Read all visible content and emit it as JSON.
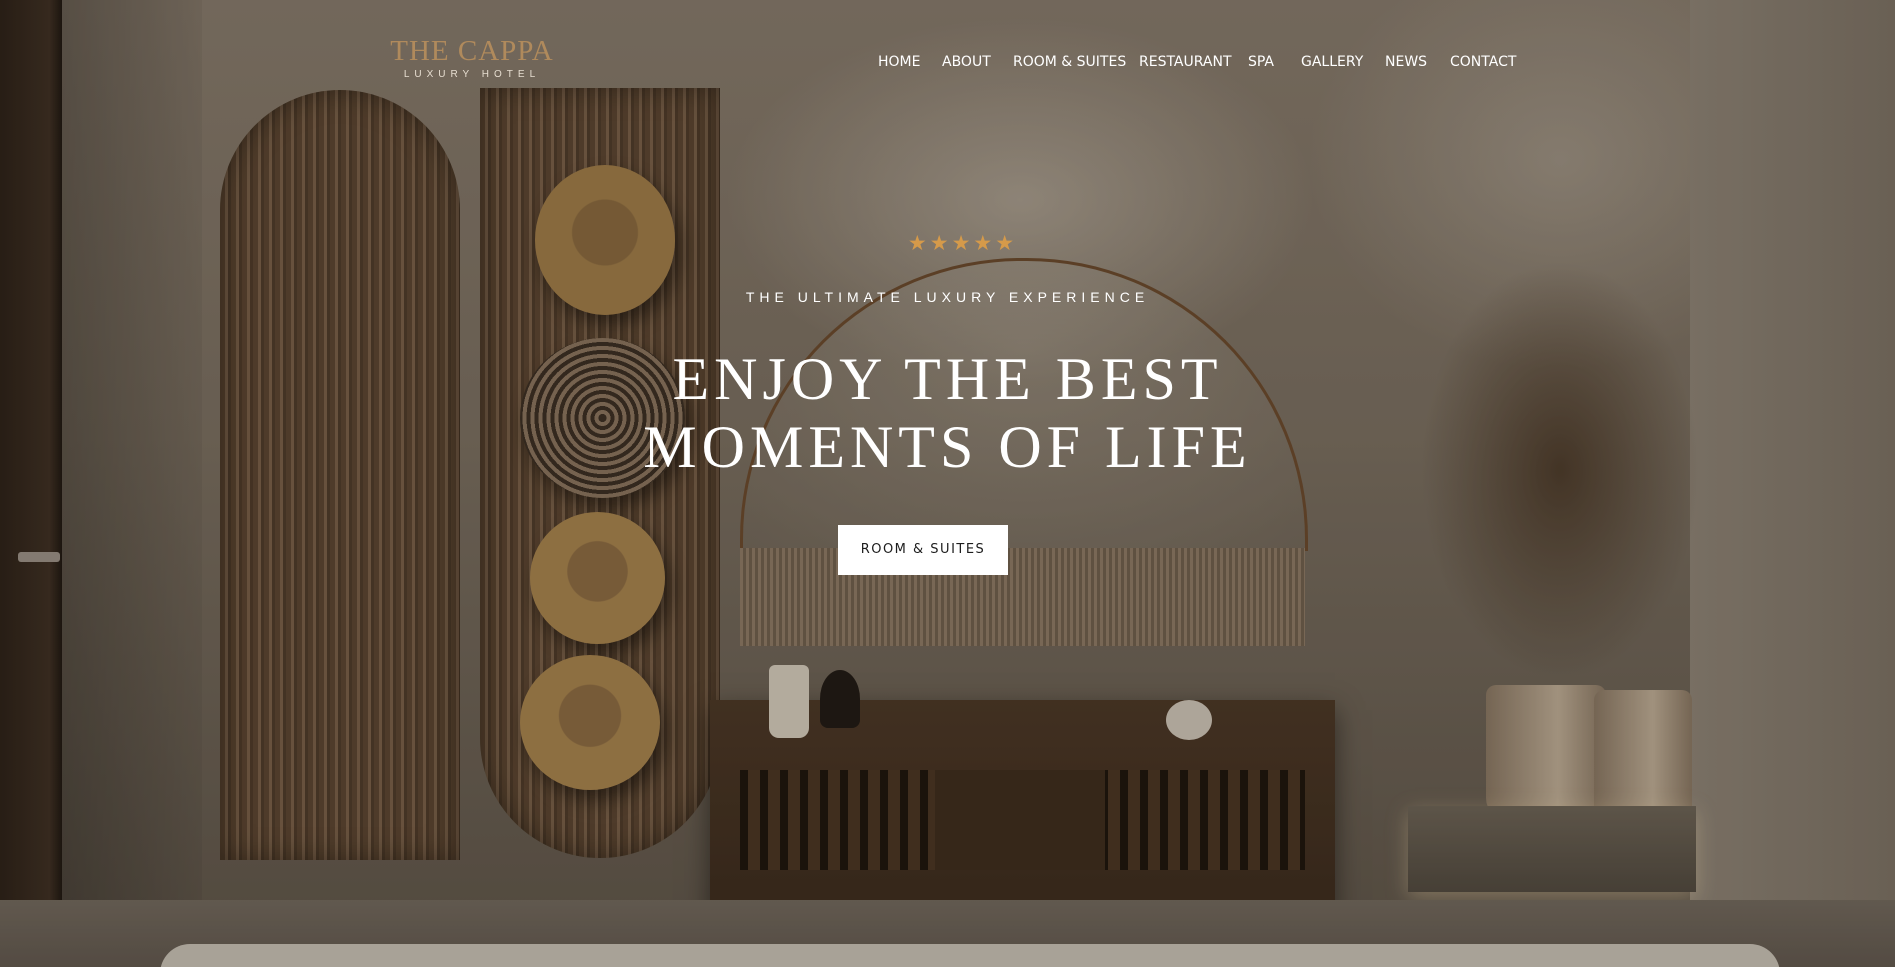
{
  "brand": {
    "name": "THE CAPPA",
    "tagline": "LUXURY HOTEL"
  },
  "nav": {
    "items": [
      {
        "label": "HOME"
      },
      {
        "label": "ABOUT"
      },
      {
        "label": "ROOM & SUITES"
      },
      {
        "label": "RESTAURANT"
      },
      {
        "label": "SPA"
      },
      {
        "label": "GALLERY"
      },
      {
        "label": "NEWS"
      },
      {
        "label": "CONTACT"
      }
    ]
  },
  "hero": {
    "rating_stars": 5,
    "stars_text": "★★★★★",
    "subtitle": "THE ULTIMATE LUXURY EXPERIENCE",
    "headline_line1": "ENJOY THE BEST",
    "headline_line2": "MOMENTS OF LIFE",
    "cta_label": "ROOM & SUITES"
  },
  "colors": {
    "brand_gold": "#b08a5c",
    "star_color": "#d59a4a",
    "text_light": "#ffffff",
    "button_bg": "#ffffff",
    "button_text": "#1d1d1d"
  }
}
